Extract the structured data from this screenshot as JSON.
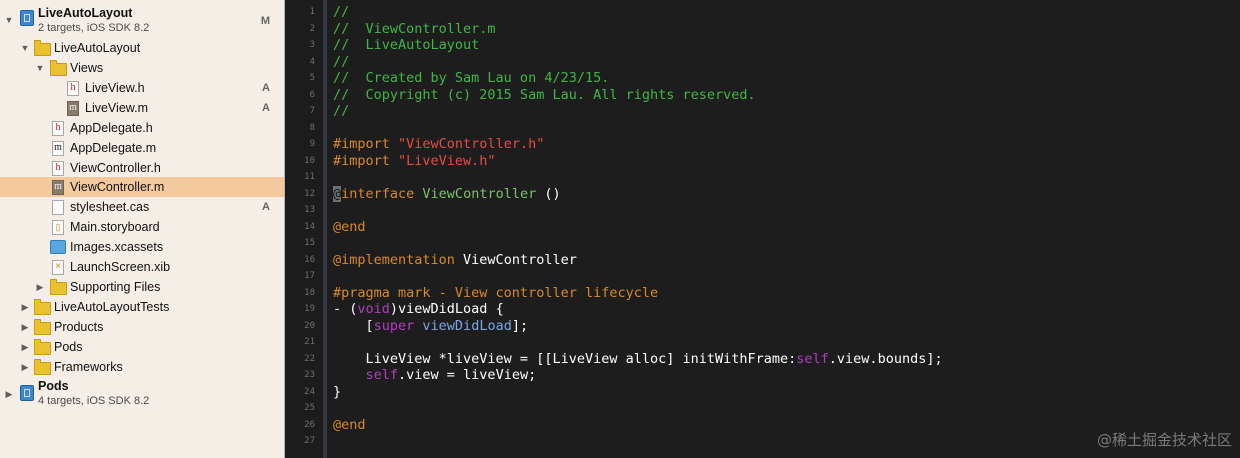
{
  "navigator": {
    "project": {
      "name": "LiveAutoLayout",
      "subtitle": "2 targets, iOS SDK 8.2",
      "badge": "M"
    },
    "items": [
      {
        "label": "LiveAutoLayout",
        "badge": ""
      },
      {
        "label": "Views",
        "badge": ""
      },
      {
        "label": "LiveView.h",
        "badge": "A"
      },
      {
        "label": "LiveView.m",
        "badge": "A"
      },
      {
        "label": "AppDelegate.h",
        "badge": ""
      },
      {
        "label": "AppDelegate.m",
        "badge": ""
      },
      {
        "label": "ViewController.h",
        "badge": ""
      },
      {
        "label": "ViewController.m",
        "badge": ""
      },
      {
        "label": "stylesheet.cas",
        "badge": "A"
      },
      {
        "label": "Main.storyboard",
        "badge": ""
      },
      {
        "label": "Images.xcassets",
        "badge": ""
      },
      {
        "label": "LaunchScreen.xib",
        "badge": ""
      },
      {
        "label": "Supporting Files",
        "badge": ""
      },
      {
        "label": "LiveAutoLayoutTests",
        "badge": ""
      },
      {
        "label": "Products",
        "badge": ""
      },
      {
        "label": "Pods",
        "badge": ""
      },
      {
        "label": "Frameworks",
        "badge": ""
      }
    ],
    "pods_project": {
      "name": "Pods",
      "subtitle": "4 targets, iOS SDK 8.2"
    }
  },
  "editor": {
    "line_numbers": [
      "1",
      "2",
      "3",
      "4",
      "5",
      "6",
      "7",
      "8",
      "9",
      "10",
      "11",
      "12",
      "13",
      "14",
      "15",
      "16",
      "17",
      "18",
      "19",
      "20",
      "21",
      "22",
      "23",
      "24",
      "25",
      "26",
      "27"
    ],
    "lines": {
      "l1": "//",
      "l2": "//  ViewController.m",
      "l3": "//  LiveAutoLayout",
      "l4": "//",
      "l5": "//  Created by Sam Lau on 4/23/15.",
      "l6": "//  Copyright (c) 2015 Sam Lau. All rights reserved.",
      "l7": "//",
      "l9_kw": "#import ",
      "l9_str": "\"ViewController.h\"",
      "l10_kw": "#import ",
      "l10_str": "\"LiveView.h\"",
      "l12_cursor": "@",
      "l12_kw": "interface",
      "l12_cls": " ViewController",
      "l12_rest": " ()",
      "l14": "@end",
      "l16_kw": "@implementation",
      "l16_rest": " ViewController",
      "l18": "#pragma mark - View controller lifecycle",
      "l19_a": "- (",
      "l19_kw": "void",
      "l19_b": ")viewDidLoad {",
      "l20_a": "    [",
      "l20_kw": "super",
      "l20_sp": " ",
      "l20_m": "viewDidLoad",
      "l20_b": "];",
      "l22_a": "    LiveView *liveView = [[LiveView alloc] initWithFrame:",
      "l22_kw": "self",
      "l22_b": ".view.bounds];",
      "l23_a": "    ",
      "l23_kw": "self",
      "l23_b": ".view = liveView;",
      "l24": "}",
      "l26": "@end"
    }
  },
  "watermark": "@稀土掘金技术社区",
  "colors": {
    "navigator_bg": "#f4eee7",
    "selection": "#f4c99e",
    "editor_bg": "#1d1d1d",
    "comment": "#41b645",
    "string": "#e34d41",
    "keyword": "#b23cc2",
    "preprocessor": "#d9882a"
  },
  "icons": [
    "disclosure-triangle-icon",
    "project-icon",
    "folder-icon",
    "header-file-icon",
    "implementation-file-icon",
    "stylesheet-file-icon",
    "storyboard-icon",
    "asset-catalog-icon",
    "xib-file-icon"
  ]
}
